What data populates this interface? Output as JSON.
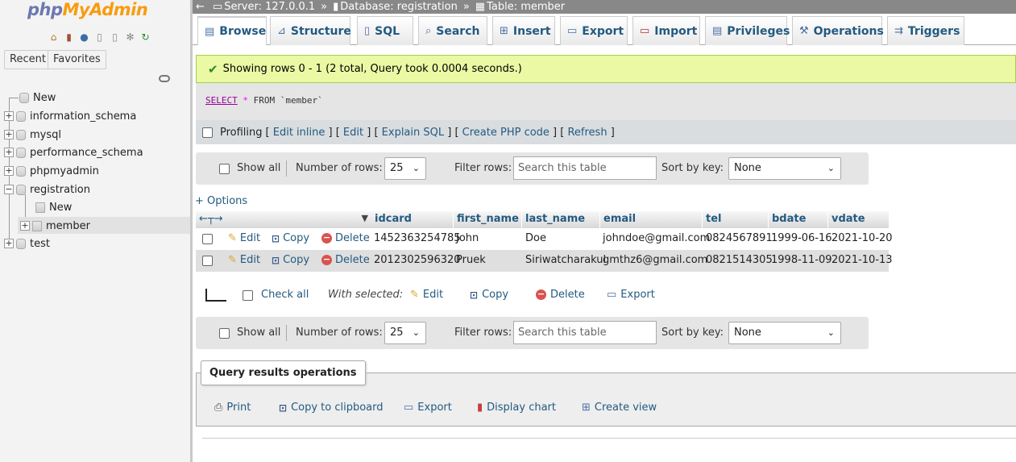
{
  "app": {
    "logo_php": "php",
    "logo_myadmin": "MyAdmin"
  },
  "sidebar": {
    "tab_recent": "Recent",
    "tab_favorites": "Favorites",
    "tree": {
      "new": "New",
      "db1": "information_schema",
      "db2": "mysql",
      "db3": "performance_schema",
      "db4": "phpmyadmin",
      "db5": "registration",
      "db5_new": "New",
      "db5_table": "member",
      "db6": "test"
    }
  },
  "breadcrumb": {
    "server": "Server: 127.0.0.1",
    "database": "Database: registration",
    "table": "Table: member"
  },
  "tabs": {
    "browse": "Browse",
    "structure": "Structure",
    "sql": "SQL",
    "search": "Search",
    "insert": "Insert",
    "export": "Export",
    "import": "Import",
    "privileges": "Privileges",
    "operations": "Operations",
    "triggers": "Triggers"
  },
  "message": {
    "success": "Showing rows 0 - 1 (2 total, Query took 0.0004 seconds.)"
  },
  "query": {
    "select": "SELECT",
    "star": "*",
    "from": "FROM",
    "table": "`member`"
  },
  "profiling": {
    "label": "Profiling",
    "edit_inline": "Edit inline",
    "edit": "Edit",
    "explain": "Explain SQL",
    "php_code": "Create PHP code",
    "refresh": "Refresh"
  },
  "nav": {
    "show_all": "Show all",
    "rows_label": "Number of rows:",
    "rows_value": "25",
    "filter_label": "Filter rows:",
    "filter_placeholder": "Search this table",
    "sort_label": "Sort by key:",
    "sort_value": "None"
  },
  "table": {
    "options": "+ Options",
    "columns": [
      "idcard",
      "first_name",
      "last_name",
      "email",
      "tel",
      "bdate",
      "vdate"
    ],
    "action_edit": "Edit",
    "action_copy": "Copy",
    "action_delete": "Delete",
    "rows": [
      [
        "1452363254785",
        "John",
        "Doe",
        "johndoe@gmail.com",
        "0824567891",
        "1999-06-16",
        "2021-10-20"
      ],
      [
        "2012302596320",
        "Pruek",
        "Siriwatcharakul",
        "gmthz6@gmail.com",
        "0821514305",
        "1998-11-09",
        "2021-10-13"
      ]
    ]
  },
  "bulk": {
    "check_all": "Check all",
    "with_selected": "With selected:",
    "edit": "Edit",
    "copy": "Copy",
    "delete": "Delete",
    "export": "Export"
  },
  "qro": {
    "title": "Query results operations",
    "print": "Print",
    "copy_clipboard": "Copy to clipboard",
    "export": "Export",
    "display_chart": "Display chart",
    "create_view": "Create view"
  }
}
